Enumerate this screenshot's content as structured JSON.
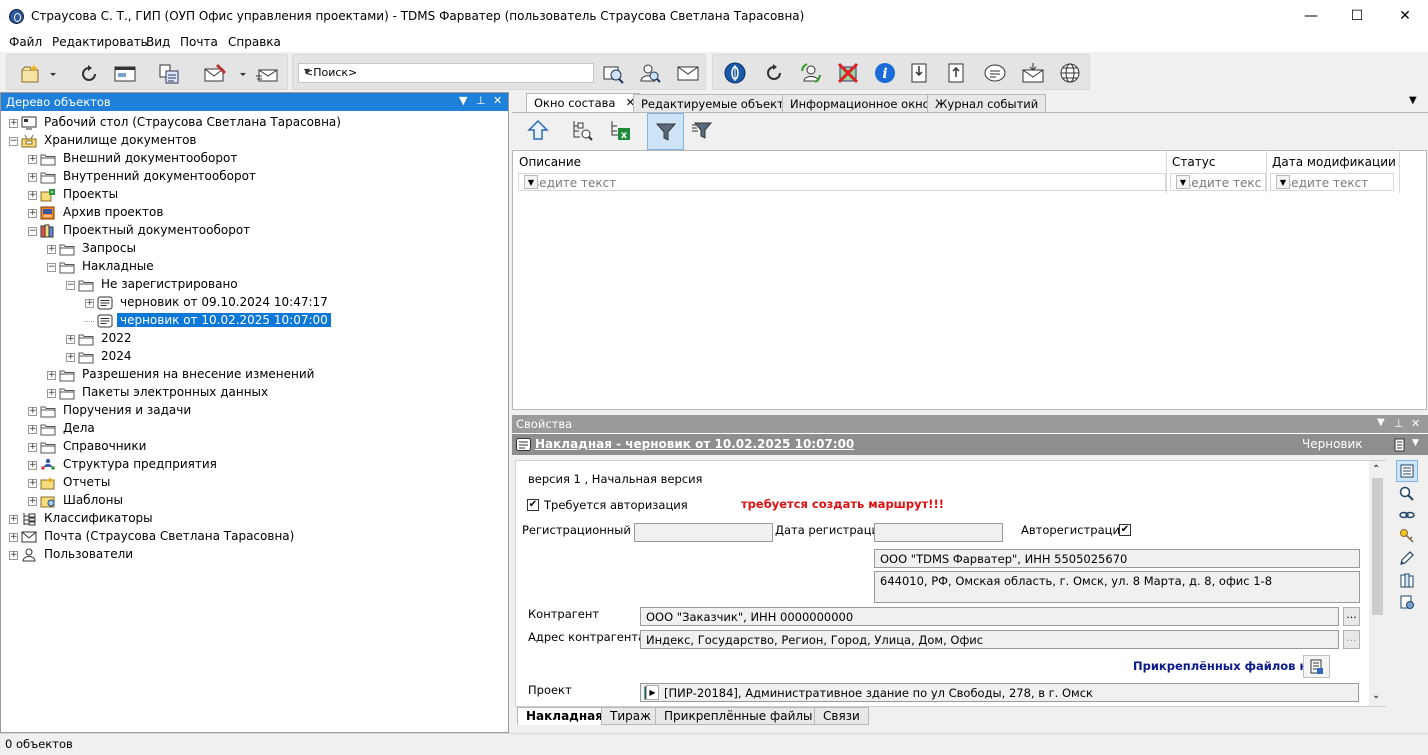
{
  "window": {
    "title": "Страусова С. Т., ГИП (ОУП Офис управления проектами) - TDMS Фарватер (пользователь Страусова Светлана Тарасовна)",
    "minimize": "—",
    "maximize": "☐",
    "close": "✕"
  },
  "menu": [
    "Файл",
    "Редактировать",
    "Вид",
    "Почта",
    "Справка"
  ],
  "toolbar": {
    "search_placeholder": "<Поиск>"
  },
  "tree_panel": {
    "title": "Дерево объектов",
    "items": [
      {
        "label": "Рабочий стол (Страусова Светлана Тарасовна)",
        "level": 0,
        "exp": "+",
        "icon": "desktop-icon"
      },
      {
        "label": "Хранилище документов",
        "level": 0,
        "exp": "−",
        "icon": "storage-icon"
      },
      {
        "label": "Внешний документооборот",
        "level": 1,
        "exp": "+",
        "icon": "folder-icon"
      },
      {
        "label": "Внутренний документооборот",
        "level": 1,
        "exp": "+",
        "icon": "folder-icon"
      },
      {
        "label": "Проекты",
        "level": 1,
        "exp": "+",
        "icon": "projects-icon"
      },
      {
        "label": "Архив проектов",
        "level": 1,
        "exp": "+",
        "icon": "archive-icon"
      },
      {
        "label": "Проектный документооборот",
        "level": 1,
        "exp": "−",
        "icon": "books-icon"
      },
      {
        "label": "Запросы",
        "level": 2,
        "exp": "+",
        "icon": "folder-icon"
      },
      {
        "label": "Накладные",
        "level": 2,
        "exp": "−",
        "icon": "folder-icon"
      },
      {
        "label": "Не зарегистрировано",
        "level": 3,
        "exp": "−",
        "icon": "folder-icon"
      },
      {
        "label": "черновик от 09.10.2024 10:47:17",
        "level": 4,
        "exp": "+",
        "icon": "document-icon"
      },
      {
        "label": "черновик от 10.02.2025 10:07:00",
        "level": 4,
        "exp": "",
        "icon": "document-icon",
        "selected": true
      },
      {
        "label": "2022",
        "level": 3,
        "exp": "+",
        "icon": "folder-icon"
      },
      {
        "label": "2024",
        "level": 3,
        "exp": "+",
        "icon": "folder-icon"
      },
      {
        "label": "Разрешения на внесение изменений",
        "level": 2,
        "exp": "+",
        "icon": "folder-icon"
      },
      {
        "label": "Пакеты электронных данных",
        "level": 2,
        "exp": "+",
        "icon": "folder-icon"
      },
      {
        "label": "Поручения и задачи",
        "level": 1,
        "exp": "+",
        "icon": "folder-icon"
      },
      {
        "label": "Дела",
        "level": 1,
        "exp": "+",
        "icon": "folder-icon"
      },
      {
        "label": "Справочники",
        "level": 1,
        "exp": "+",
        "icon": "folder-icon"
      },
      {
        "label": "Структура предприятия",
        "level": 1,
        "exp": "+",
        "icon": "org-icon"
      },
      {
        "label": "Отчеты",
        "level": 1,
        "exp": "+",
        "icon": "reports-icon"
      },
      {
        "label": "Шаблоны",
        "level": 1,
        "exp": "+",
        "icon": "templates-icon"
      },
      {
        "label": "Классификаторы",
        "level": 0,
        "exp": "+",
        "icon": "classifier-icon"
      },
      {
        "label": "Почта (Страусова Светлана Тарасовна)",
        "level": 0,
        "exp": "+",
        "icon": "mail-icon"
      },
      {
        "label": "Пользователи",
        "level": 0,
        "exp": "+",
        "icon": "user-icon"
      }
    ]
  },
  "tabs": [
    "Окно состава",
    "Редактируемые объекты",
    "Информационное окно",
    "Журнал событий"
  ],
  "grid": {
    "columns": [
      "Описание",
      "Статус",
      "Дата модификации"
    ],
    "filter_placeholder": "Введите текст",
    "filter_placeholder_short": "Введите текс"
  },
  "properties": {
    "panel_title": "Свойства",
    "object_title": "Накладная -  черновик от 10.02.2025 10:07:00",
    "status": "Черновик",
    "version": "версия 1 , Начальная версия",
    "auth_required_label": "Требуется авторизация",
    "route_warning": "требуется создать маршрут!!!",
    "reg_no_label": "Регистрационный №",
    "reg_date_label": "Дата регистрации",
    "auto_reg_label": "Авторегистрация",
    "org": "ООО \"TDMS Фарватер\", ИНН 5505025670",
    "org_address": "644010, РФ, Омская область, г. Омск, ул. 8 Марта, д. 8, офис 1-8",
    "counterparty_label": "Контрагент",
    "counterparty": "ООО \"Заказчик\", ИНН 0000000000",
    "counterparty_address_label": "Адрес контрагента",
    "counterparty_address": "Индекс, Государство, Регион, Город, Улица, Дом, Офис",
    "no_files": "Прикреплённых файлов нет",
    "project_label": "Проект",
    "project": "[ПИР-20184], Административное здание по ул Свободы, 278, в г. Омск",
    "ellipsis": "...",
    "bottom_tabs": [
      "Накладная",
      "Тираж",
      "Прикреплённые файлы",
      "Связи"
    ]
  },
  "status_bar": {
    "text": "0 объектов"
  }
}
